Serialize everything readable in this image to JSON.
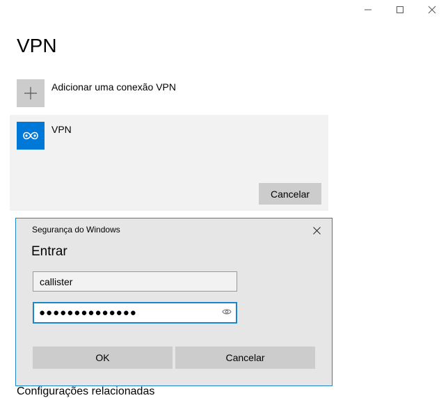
{
  "window": {
    "controls": [
      "minimize",
      "maximize",
      "close"
    ]
  },
  "page": {
    "title": "VPN"
  },
  "add_connection": {
    "label": "Adicionar uma conexão VPN",
    "icon": "plus-icon"
  },
  "vpn_entry": {
    "name": "VPN",
    "icon": "vpn-icon",
    "cancel_label": "Cancelar"
  },
  "partial_below": {
    "text": "Configurações relacionadas"
  },
  "dialog": {
    "caption": "Segurança do Windows",
    "heading": "Entrar",
    "username": "callister",
    "password_masked": "●●●●●●●●●●●●●●",
    "ok_label": "OK",
    "cancel_label": "Cancelar",
    "accent": "#1c84c9"
  },
  "colors": {
    "vpn_tile": "#0078d7",
    "panel": "#f2f2f2",
    "button": "#cccccc",
    "dialog_bg": "#e6e6e6"
  }
}
